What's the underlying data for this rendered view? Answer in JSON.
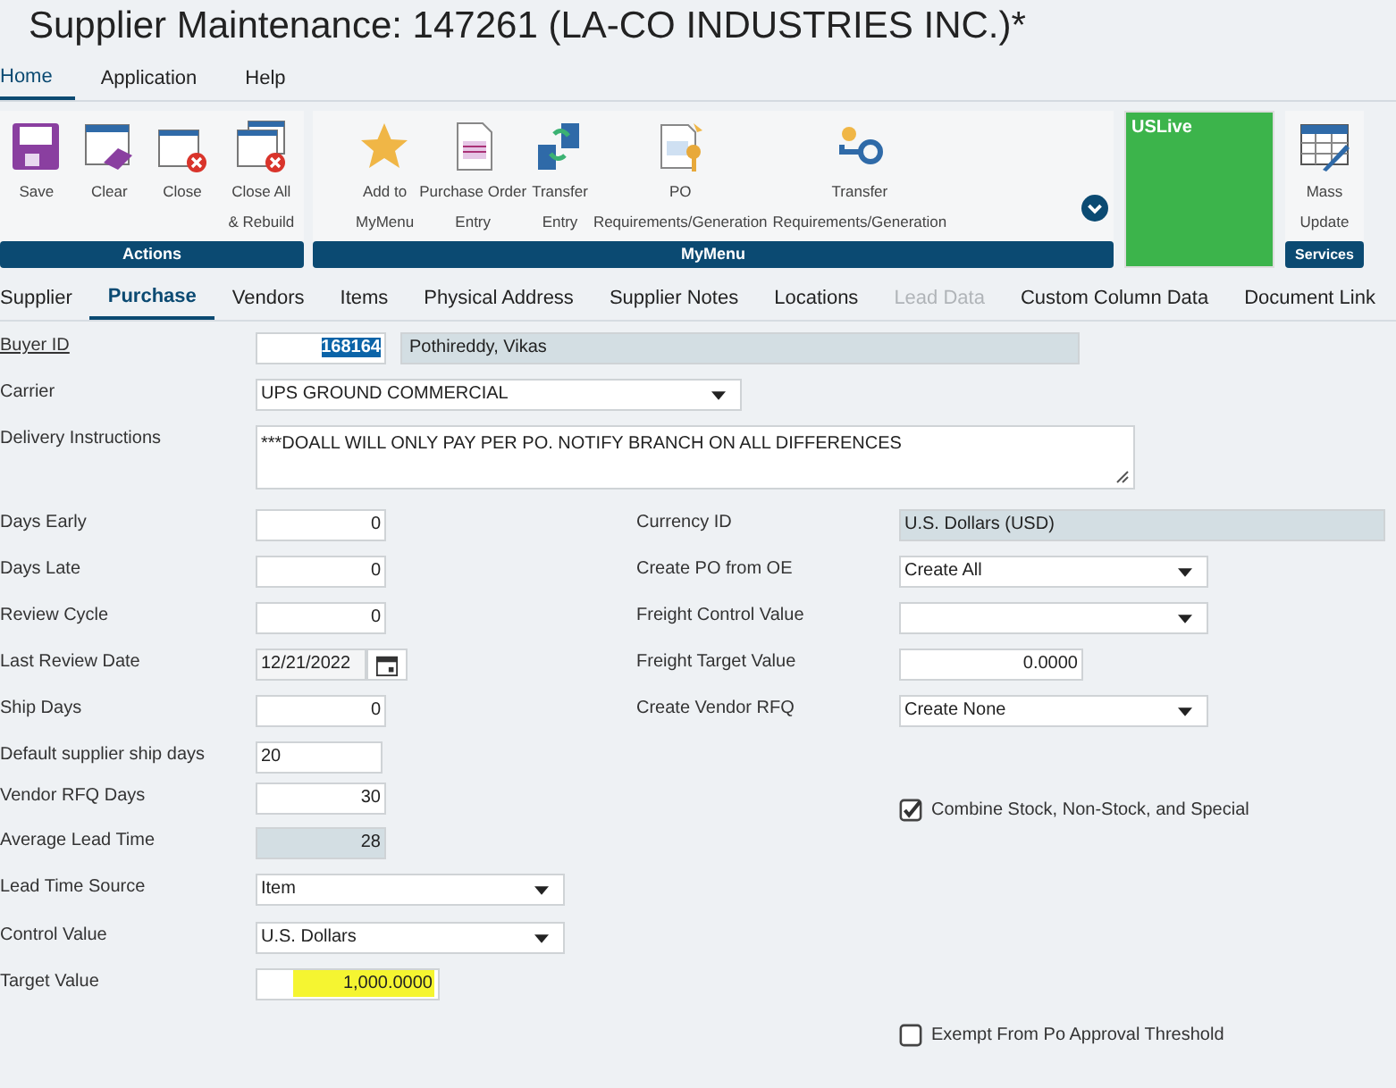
{
  "window": {
    "title": "Supplier Maintenance: 147261 (LA-CO INDUSTRIES INC.)*"
  },
  "menu_tabs": [
    {
      "label": "Home",
      "selected": true
    },
    {
      "label": "Application",
      "selected": false
    },
    {
      "label": "Help",
      "selected": false
    }
  ],
  "ribbon": {
    "groups": [
      {
        "title": "Actions",
        "buttons": [
          {
            "lines": [
              "Save"
            ]
          },
          {
            "lines": [
              "Clear"
            ]
          },
          {
            "lines": [
              "Close"
            ]
          },
          {
            "lines": [
              "Close All",
              "& Rebuild"
            ]
          }
        ]
      },
      {
        "title": "MyMenu",
        "buttons": [
          {
            "lines": [
              "Add to",
              "MyMenu"
            ]
          },
          {
            "lines": [
              "Purchase Order",
              "Entry"
            ]
          },
          {
            "lines": [
              "Transfer",
              "Entry"
            ]
          },
          {
            "lines": [
              "PO",
              "Requirements/Generation"
            ]
          },
          {
            "lines": [
              "Transfer",
              "Requirements/Generation"
            ]
          }
        ]
      }
    ],
    "environment": "USLive",
    "services": {
      "title": "Services",
      "buttons": [
        {
          "lines": [
            "Mass",
            "Update"
          ]
        }
      ]
    }
  },
  "tabs": [
    {
      "label": "Supplier",
      "selected": false,
      "disabled": false
    },
    {
      "label": "Purchase",
      "selected": true,
      "disabled": false
    },
    {
      "label": "Vendors",
      "selected": false,
      "disabled": false
    },
    {
      "label": "Items",
      "selected": false,
      "disabled": false
    },
    {
      "label": "Physical Address",
      "selected": false,
      "disabled": false
    },
    {
      "label": "Supplier Notes",
      "selected": false,
      "disabled": false
    },
    {
      "label": "Locations",
      "selected": false,
      "disabled": false
    },
    {
      "label": "Lead Data",
      "selected": false,
      "disabled": true
    },
    {
      "label": "Custom Column Data",
      "selected": false,
      "disabled": false
    },
    {
      "label": "Document Link",
      "selected": false,
      "disabled": false
    }
  ],
  "buyer": {
    "label": "Buyer ID",
    "value": "168164",
    "text_selected": true,
    "name": "Pothireddy, Vikas"
  },
  "carrier": {
    "label": "Carrier",
    "value": "UPS GROUND COMMERCIAL"
  },
  "delivery_instructions": {
    "label": "Delivery Instructions",
    "value": "***DOALL WILL ONLY PAY PER PO. NOTIFY BRANCH ON ALL DIFFERENCES"
  },
  "left_fields": [
    {
      "label": "Days Early",
      "kind": "number",
      "value": "0"
    },
    {
      "label": "Days Late",
      "kind": "number",
      "value": "0"
    },
    {
      "label": "Review Cycle",
      "kind": "number",
      "value": "0"
    },
    {
      "label": "Last Review Date",
      "kind": "date",
      "value": "12/21/2022"
    },
    {
      "label": "Ship Days",
      "kind": "number",
      "value": "0"
    },
    {
      "label": "Default supplier ship days",
      "kind": "text",
      "value": "20"
    },
    {
      "label": "Vendor RFQ Days",
      "kind": "number",
      "value": "30"
    },
    {
      "label": "Average Lead Time",
      "kind": "readonly",
      "value": "28"
    },
    {
      "label": "Lead Time Source",
      "kind": "select",
      "value": "Item"
    },
    {
      "label": "Control Value",
      "kind": "select",
      "value": "U.S. Dollars"
    },
    {
      "label": "Target Value",
      "kind": "number",
      "value": "1,000.0000",
      "highlighted": true
    }
  ],
  "right_fields": [
    {
      "label": "Currency ID",
      "kind": "readonly",
      "value": "U.S. Dollars (USD)"
    },
    {
      "label": "Create PO from OE",
      "kind": "select",
      "value": "Create All"
    },
    {
      "label": "Freight Control Value",
      "kind": "select"
    },
    {
      "label": "Freight Target Value",
      "kind": "number",
      "value": "0.0000"
    },
    {
      "label": "Create Vendor RFQ",
      "kind": "select",
      "value": "Create None"
    }
  ],
  "checkboxes": [
    {
      "label": "Combine Stock, Non-Stock, and Special",
      "checked": true
    },
    {
      "label": "Exempt From Po Approval Threshold",
      "checked": false
    }
  ]
}
